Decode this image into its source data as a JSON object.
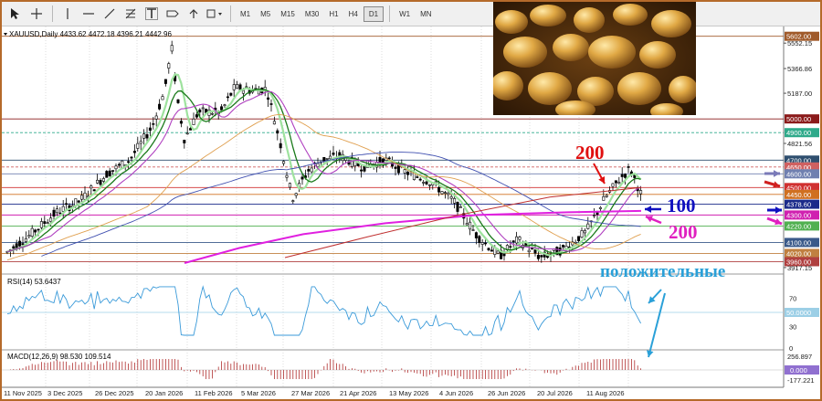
{
  "toolbar": {
    "icons": [
      "cursor-icon",
      "crosshair-icon",
      "vertical-line-icon",
      "horizontal-line-icon",
      "trendline-icon",
      "fibonacci-icon",
      "text-icon",
      "label-icon",
      "arrows-icon",
      "shapes-icon"
    ],
    "timeframes": [
      "M1",
      "M5",
      "M15",
      "M30",
      "H1",
      "H4",
      "D1",
      "W1",
      "MN"
    ],
    "active_timeframe": "D1"
  },
  "chart": {
    "symbol_line": "XAUUSD,Daily  4433.62 4472.18 4396.21 4442.96",
    "rsi_label": "RSI(14) 53.6437",
    "macd_label": "MACD(12,26,9) 98.530 109.514",
    "annotation_text": "положительные"
  },
  "chart_data": {
    "type": "line",
    "price_scale": [
      "5552.15",
      "5366.86",
      "5187.00",
      "4821.56",
      "3917.15"
    ],
    "price_levels": [
      {
        "label": "5602.00",
        "color": "#a05a2a"
      },
      {
        "label": "5000.00",
        "color": "#8b1a1a"
      },
      {
        "label": "4900.00",
        "color": "#2eaa8a"
      },
      {
        "label": "4700.00",
        "color": "#2f4f6f"
      },
      {
        "label": "4650.00",
        "color": "#d06060"
      },
      {
        "label": "4600.00",
        "color": "#7080b0"
      },
      {
        "label": "4500.00",
        "color": "#d03030"
      },
      {
        "label": "4450.00",
        "color": "#d07020"
      },
      {
        "label": "4378.60",
        "color": "#1a2a8a"
      },
      {
        "label": "4300.00",
        "color": "#d020b0"
      },
      {
        "label": "4220.00",
        "color": "#50b050"
      },
      {
        "label": "4100.00",
        "color": "#3a5a8a"
      },
      {
        "label": "4020.00",
        "color": "#c08040"
      },
      {
        "label": "3960.00",
        "color": "#b04040"
      }
    ],
    "rsi_scale": [
      "70",
      "50",
      "30",
      "0"
    ],
    "rsi_level": "50.0000",
    "macd_scale": [
      "256.897",
      "-177.221"
    ],
    "macd_level": "0.000",
    "dates": [
      "11 Nov 2025",
      "3 Dec 2025",
      "26 Dec 2025",
      "20 Jan 2026",
      "11 Feb 2026",
      "5 Mar 2026",
      "27 Mar 2026",
      "21 Apr 2026",
      "13 May 2026",
      "4 Jun 2026",
      "26 Jun 2026",
      "20 Jul 2026",
      "11 Aug 2026"
    ],
    "annotations": [
      {
        "text": "200",
        "color": "#e01010"
      },
      {
        "text": "100",
        "color": "#1010c0"
      },
      {
        "text": "200",
        "color": "#e020c0"
      }
    ]
  }
}
